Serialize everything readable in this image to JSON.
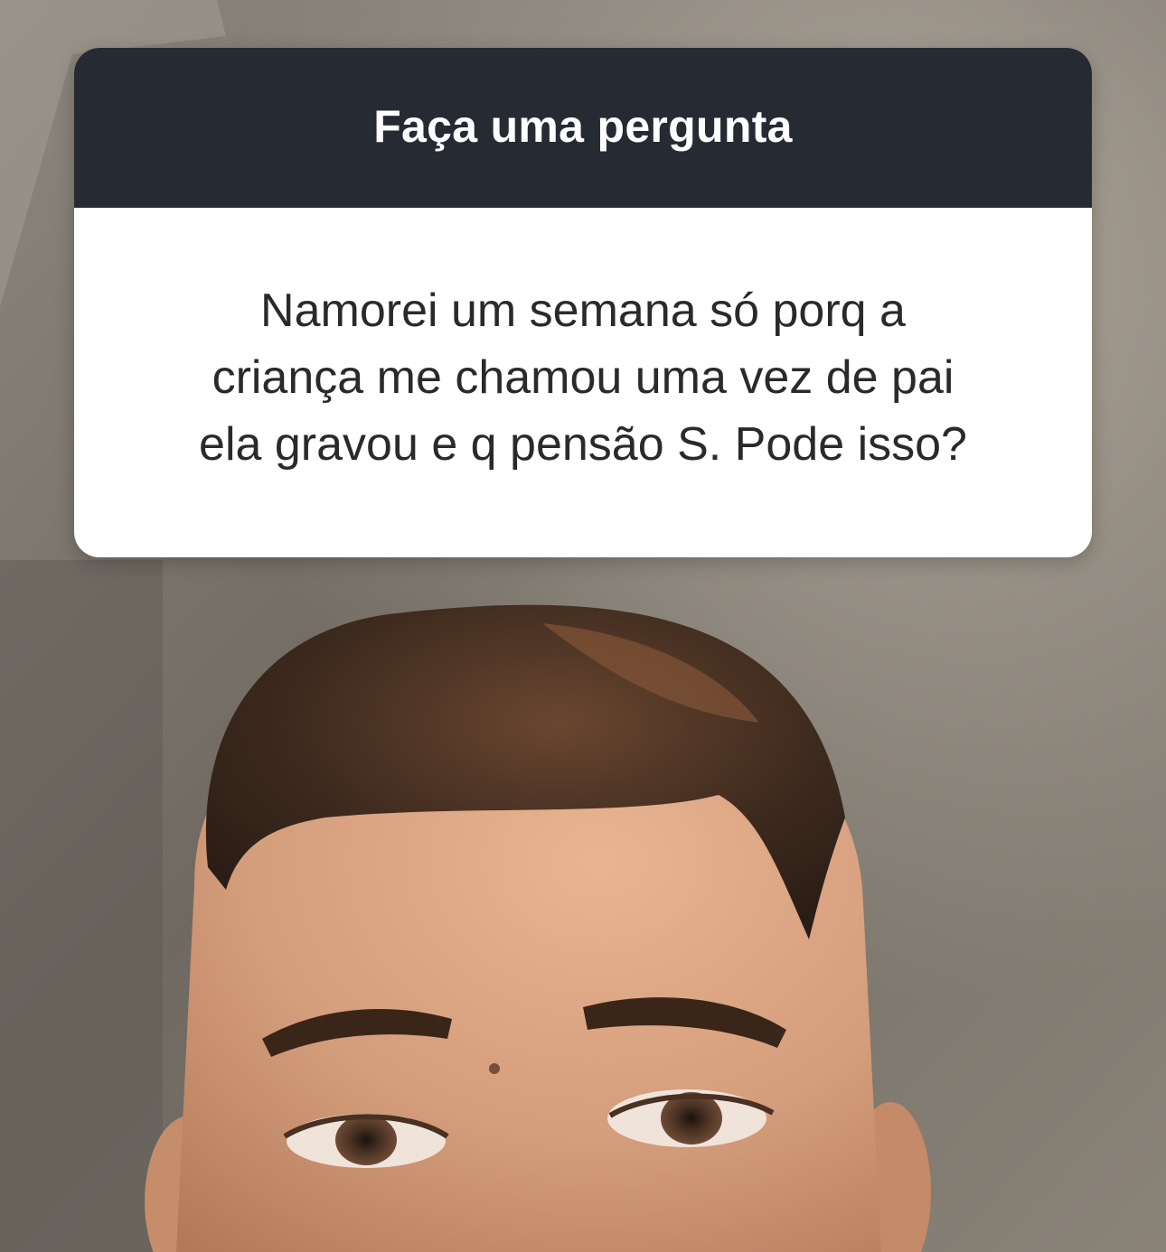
{
  "question_box": {
    "title": "Faça uma pergunta",
    "question": "Namorei um semana só porq a\ncriança me chamou uma vez de pai\nela gravou e q pensão S. Pode isso?"
  },
  "colors": {
    "header_bg": "#262a33",
    "card_bg": "#ffffff",
    "header_text": "#ffffff",
    "question_text": "#2a2a2a"
  },
  "background": {
    "subject": "selfie-video-frame"
  }
}
